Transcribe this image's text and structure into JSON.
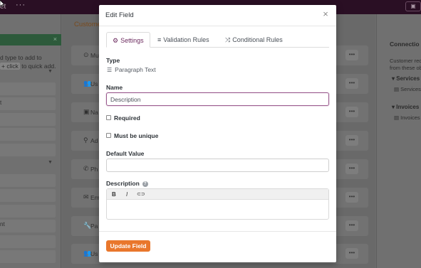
{
  "background": {
    "topbar": {
      "title": "et",
      "more": "···"
    },
    "left": {
      "help_line1": "d type to add to",
      "help_line2_kbd": "+ click",
      "help_line2_rest": "to quick add.",
      "text_at": "t",
      "text_nt": "nt"
    },
    "middle": {
      "tab": "Custome",
      "rows": [
        {
          "icon": "⊙",
          "label": "Mu"
        },
        {
          "icon": "👥",
          "label": "Us"
        },
        {
          "icon": "▣",
          "label": "Na"
        },
        {
          "icon": "⚲",
          "label": "Ad"
        },
        {
          "icon": "✆",
          "label": "Ph"
        },
        {
          "icon": "✉",
          "label": "Em"
        },
        {
          "icon": "🔧",
          "label": "Pa"
        },
        {
          "icon": "👥",
          "label": "Us"
        }
      ],
      "row_menu": "•••"
    },
    "right": {
      "title": "Connectio",
      "desc1": "Customer rec",
      "desc2": "from these ob",
      "sections": [
        {
          "label": "Services",
          "item": "Services"
        },
        {
          "label": "Invoices",
          "item": "Invoices"
        }
      ]
    }
  },
  "modal": {
    "title": "Edit Field",
    "close_icon": "×",
    "tabs": [
      {
        "icon": "⚙",
        "label": "Settings"
      },
      {
        "icon": "≡",
        "label": "Validation Rules"
      },
      {
        "icon": "⤨",
        "label": "Conditional Rules"
      }
    ],
    "type_label": "Type",
    "type_value": "Paragraph Text",
    "name_label": "Name",
    "name_value": "Description",
    "required_label": "Required",
    "unique_label": "Must be unique",
    "default_label": "Default Value",
    "default_value": "",
    "description_label": "Description",
    "toolbar": {
      "bold": "B",
      "italic": "I",
      "link": "⊂⊃"
    },
    "description_value": "",
    "update_button": "Update Field"
  },
  "colors": {
    "accent": "#6b2a5e",
    "primary_button": "#e9772c",
    "topbar": "#2a0f24"
  }
}
